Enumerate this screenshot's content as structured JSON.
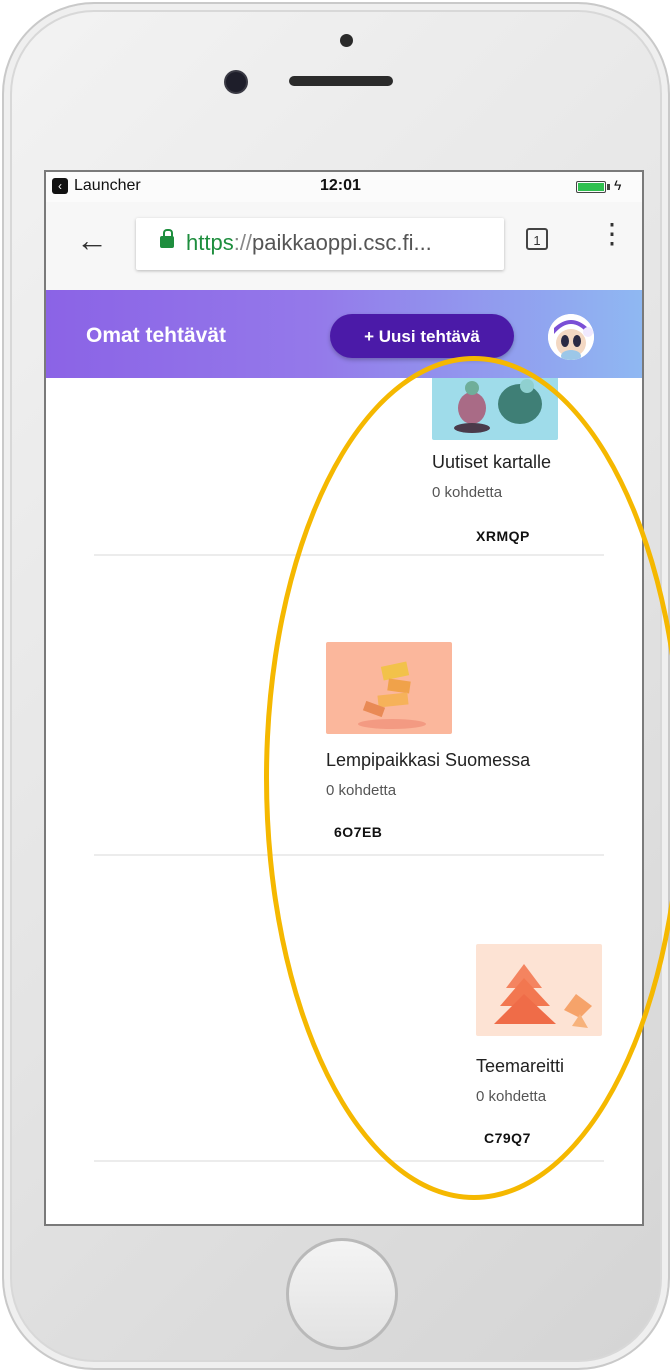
{
  "statusbar": {
    "app_label": "Launcher",
    "time": "12:01"
  },
  "browser": {
    "url_scheme": "https",
    "url_separator": "://",
    "url_host": "paikkaoppi.csc.fi...",
    "tab_count": "1",
    "menu_icon": "⋮",
    "back_icon": "←"
  },
  "header": {
    "title": "Omat tehtävät",
    "new_task_label": "+ Uusi tehtävä"
  },
  "tasks": [
    {
      "title": "Uutiset kartalle",
      "count": "0 kohdetta",
      "code": "XRMQP"
    },
    {
      "title": "Lempipaikkasi Suomessa",
      "count": "0 kohdetta",
      "code": "6O7EB"
    },
    {
      "title": "Teemareitti",
      "count": "0 kohdetta",
      "code": "C79Q7"
    }
  ],
  "colors": {
    "header_gradient_start": "#8b63e6",
    "header_gradient_end": "#8fb8f2",
    "new_task_button": "#4b1aa8",
    "highlight": "#f5b800"
  },
  "icons": {
    "back": "back-arrow-icon",
    "lock": "lock-icon",
    "tabs": "tab-count-icon",
    "menu": "overflow-menu-icon",
    "avatar": "avatar-icon",
    "charging": "charging-icon"
  }
}
